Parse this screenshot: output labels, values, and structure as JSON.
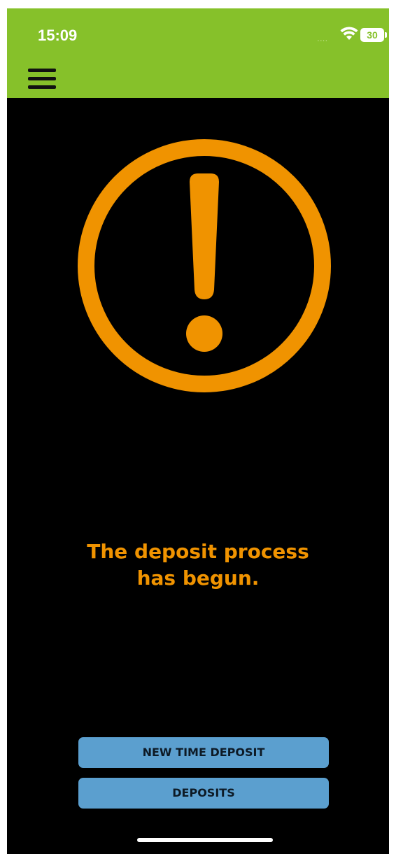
{
  "status_bar": {
    "time": "15:09",
    "signal_dots": "....",
    "battery_level": "30"
  },
  "header": {
    "menu_icon": "hamburger-menu-icon",
    "background_color": "#86c12a"
  },
  "main": {
    "icon": "exclamation-circle-icon",
    "accent_color": "#f09300",
    "message_line1": "The deposit process",
    "message_line2": "has begun."
  },
  "actions": {
    "new_time_deposit_label": "NEW TIME DEPOSIT",
    "deposits_label": "DEPOSITS",
    "button_color": "#5b9fcf"
  }
}
